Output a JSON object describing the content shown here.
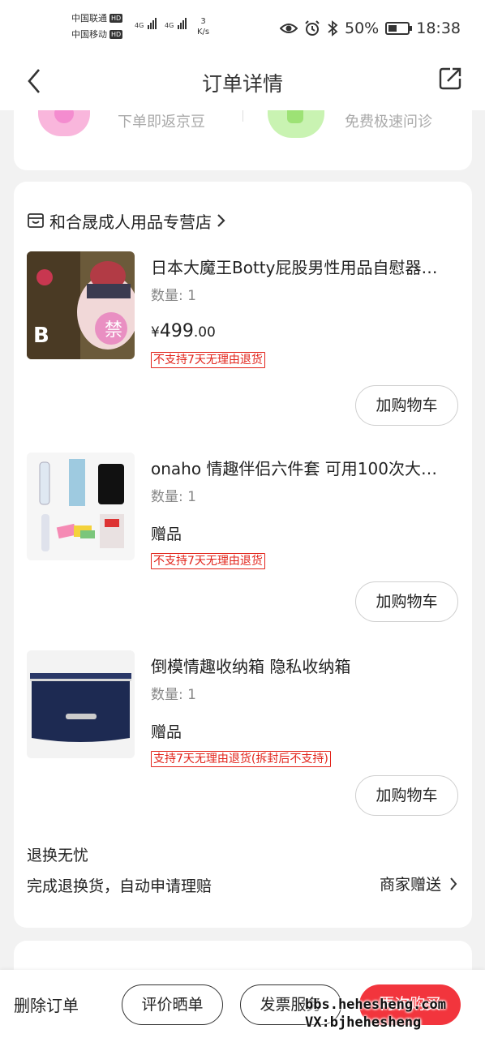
{
  "status_bar": {
    "carrier1": "中国联通",
    "carrier2": "中国移动",
    "hd_badge": "HD",
    "net1": "4G",
    "net2": "4G",
    "speed_value": "3",
    "speed_unit": "K/s",
    "battery": "50%",
    "time": "18:38"
  },
  "header": {
    "title": "订单详情"
  },
  "promo": {
    "item1": "下单即返京豆",
    "item2": "免费极速问诊"
  },
  "store": {
    "name": "和合晟成人用品专营店"
  },
  "products": [
    {
      "title": "日本大魔王Botty屁股男性用品自慰器…",
      "qty": "数量: 1",
      "price_currency": "¥",
      "price_int": "499",
      "price_dec": ".00",
      "gift_label": "",
      "policy": "不支持7天无理由退货",
      "cart_label": "加购物车"
    },
    {
      "title": "onaho 情趣伴侣六件套 可用100次大…",
      "qty": "数量: 1",
      "gift_label": "赠品",
      "policy": "不支持7天无理由退货",
      "cart_label": "加购物车"
    },
    {
      "title": "倒模情趣收纳箱 隐私收纳箱",
      "qty": "数量: 1",
      "gift_label": "赠品",
      "policy": "支持7天无理由退货(拆封后不支持)",
      "cart_label": "加购物车"
    }
  ],
  "guarantee": {
    "title": "退换无忧",
    "desc": "完成退换货，自动申请理赔",
    "right": "商家赠送"
  },
  "bottom_bar": {
    "delete": "删除订单",
    "review": "评价晒单",
    "invoice": "发票服务",
    "rebuy": "再次购买"
  },
  "watermark": {
    "line1": "bbs.hehesheng.com",
    "line2": "VX:bjhehesheng"
  },
  "colors": {
    "accent_red": "#f2353d",
    "tag_red": "#e2231a",
    "background": "#f2f2f2"
  },
  "icons": {
    "back": "back-chevron-icon",
    "share": "share-icon",
    "store": "store-icon",
    "chevron": "chevron-right-icon"
  }
}
